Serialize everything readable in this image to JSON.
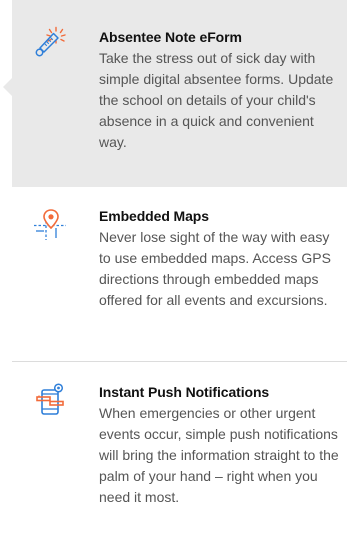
{
  "features": [
    {
      "title": "Absentee Note eForm",
      "description": "Take the stress out of sick day with simple digital absentee forms. Update the school on details of your child's absence in a quick and convenient way.",
      "icon": "thermometer-icon",
      "active": true
    },
    {
      "title": "Embedded Maps",
      "description": "Never lose sight of the way with easy to use embedded maps. Access GPS directions through embedded maps offered for all events and excursions.",
      "icon": "map-pin-icon",
      "active": false
    },
    {
      "title": "Instant Push Notifications",
      "description": "When emergencies or other urgent events occur, simple push notifications will bring the information straight to the palm of your hand – right when you need it most.",
      "icon": "phone-notification-icon",
      "active": false
    }
  ],
  "colors": {
    "active_background": "#e9e9e9",
    "icon_orange": "#f26b3a",
    "icon_blue": "#2f7fd9",
    "divider": "#dcdcdc",
    "title_text": "#111111",
    "body_text": "#555555"
  }
}
